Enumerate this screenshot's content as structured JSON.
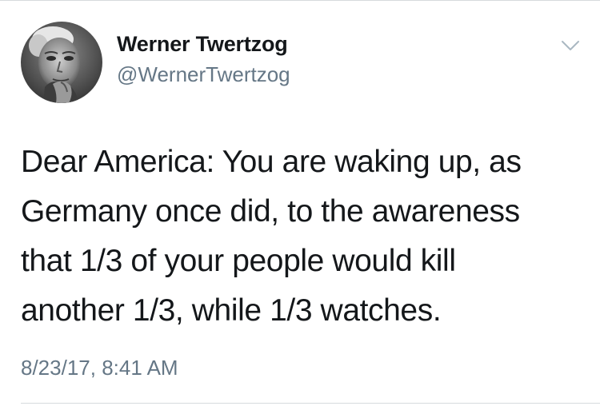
{
  "tweet": {
    "author": {
      "display_name": "Werner Twertzog",
      "handle": "@WernerTwertzog",
      "avatar_icon": "grayscale-portrait-avatar"
    },
    "menu_icon": "chevron-down-icon",
    "text_lines": [
      "Dear America: You are waking up, as",
      "Germany once did, to the awareness",
      "that 1/3 of your people would kill",
      "another 1/3, while 1/3 watches."
    ],
    "timestamp": "8/23/17, 8:41 AM"
  },
  "colors": {
    "primary_text": "#14171a",
    "secondary_text": "#657786",
    "divider": "#d6dadd",
    "caret": "#aab8c2"
  }
}
